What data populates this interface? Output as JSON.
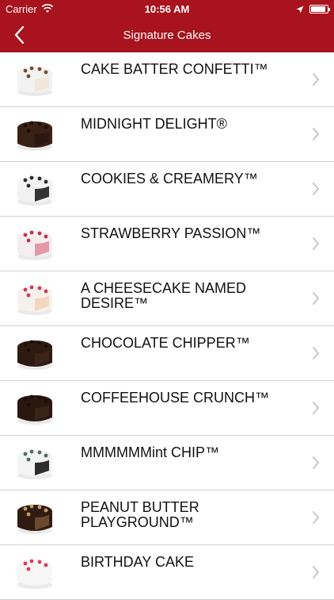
{
  "status": {
    "carrier": "Carrier",
    "time": "10:56 AM"
  },
  "nav": {
    "title": "Signature Cakes",
    "back_icon": "chevron-left-icon"
  },
  "cakes": [
    {
      "name": "CAKE BATTER CONFETTI™",
      "frost": "#f2f2f2",
      "crumb": "#f2e6d8",
      "top": "#7a4a2a"
    },
    {
      "name": "MIDNIGHT DELIGHT®",
      "frost": "#3a2116",
      "crumb": "#2b170f",
      "top": "#1c0f09"
    },
    {
      "name": "COOKIES & CREAMERY™",
      "frost": "#f2f2f2",
      "crumb": "#333333",
      "top": "#2a2a2a"
    },
    {
      "name": "STRAWBERRY PASSION™",
      "frost": "#f5eef0",
      "crumb": "#e49aa6",
      "top": "#c23150"
    },
    {
      "name": "A CHEESECAKE NAMED DESIRE™",
      "frost": "#f7f1ec",
      "crumb": "#f3d7bf",
      "top": "#cc3a5f"
    },
    {
      "name": "CHOCOLATE CHIPPER™",
      "frost": "#2f1a12",
      "crumb": "#3b241a",
      "top": "#1b0f0a"
    },
    {
      "name": "COFFEEHOUSE CRUNCH™",
      "frost": "#2a170f",
      "crumb": "#3a2418",
      "top": "#1a0d08"
    },
    {
      "name": "MMMMMMint CHIP™",
      "frost": "#f4f4f4",
      "crumb": "#2d2d2d",
      "top": "#4e6b5d"
    },
    {
      "name": "PEANUT BUTTER PLAYGROUND™",
      "frost": "#2f1b12",
      "crumb": "#6b4a2f",
      "top": "#c59d5f"
    },
    {
      "name": "BIRTHDAY CAKE",
      "frost": "#f6f6f6",
      "crumb": "#f6f6f6",
      "top": "#d93a65"
    }
  ]
}
